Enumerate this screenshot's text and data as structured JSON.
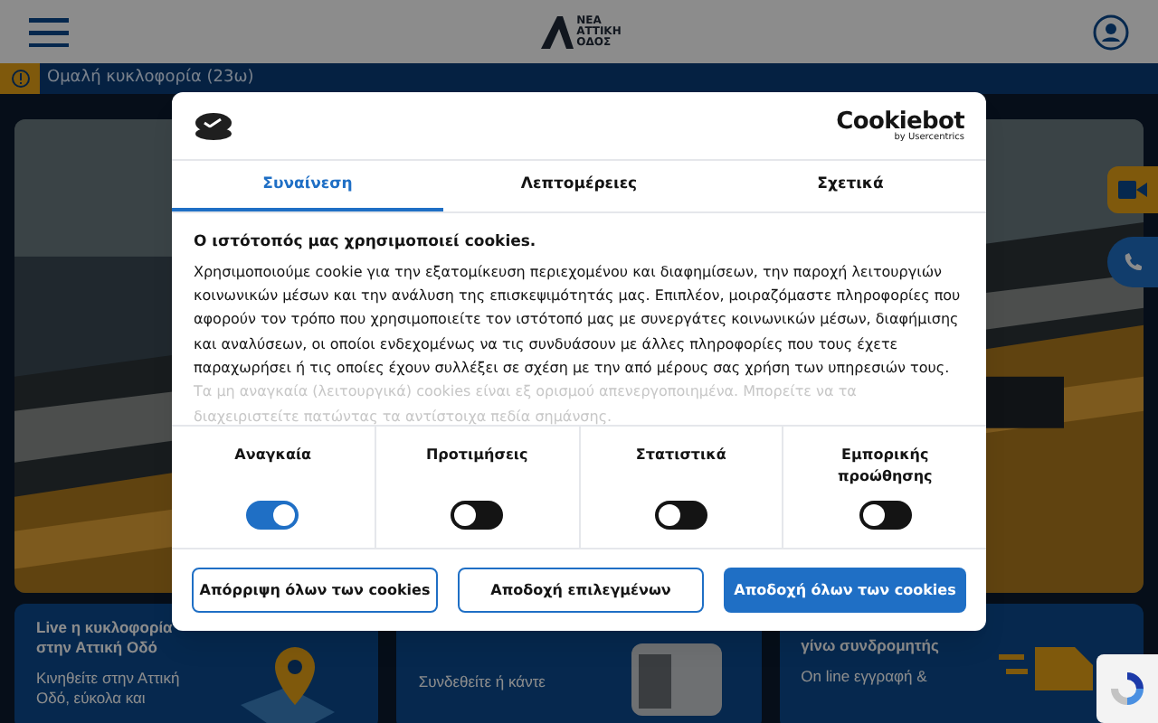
{
  "header": {
    "logo": [
      "ΝΕΑ",
      "ΑΤΤΙΚΗ",
      "ΟΔΟΣ"
    ]
  },
  "traffic_bar": {
    "text": "Ομαλή κυκλοφορία (23ω)"
  },
  "cards": [
    {
      "title": "Live η κυκλοφορία στην Αττική Οδό",
      "text": "Κινηθείτε στην Αττική Οδό, εύκολα και",
      "kind": "map"
    },
    {
      "text": "Συνδεθείτε ή κάντε",
      "kind": "pass"
    },
    {
      "title": "γίνω συνδρομητής",
      "text": "On line εγγραφή &",
      "kind": "truck"
    }
  ],
  "cookie_dialog": {
    "brand": "Cookiebot",
    "brand_sub": "by Usercentrics",
    "tabs": [
      {
        "label": "Συναίνεση",
        "selected": true
      },
      {
        "label": "Λεπτομέρειες",
        "selected": false
      },
      {
        "label": "Σχετικά",
        "selected": false
      }
    ],
    "heading": "Ο ιστότοπός μας χρησιμοποιεί cookies.",
    "body": "Χρησιμοποιούμε cookie για την εξατομίκευση περιεχομένου και διαφημίσεων, την παροχή λειτουργιών κοινωνικών μέσων και την ανάλυση της επισκεψιμότητάς μας. Επιπλέον, μοιραζόμαστε πληροφορίες που αφορούν τον τρόπο που χρησιμοποιείτε τον ιστότοπό μας με συνεργάτες κοινωνικών μέσων, διαφήμισης και αναλύσεων, οι οποίοι ενδεχομένως να τις συνδυάσουν με άλλες πληροφορίες που τους έχετε παραχωρήσει ή τις οποίες έχουν συλλέξει σε σχέση με την από μέρους σας χρήση των υπηρεσιών τους.",
    "note": "Τα μη αναγκαία (λειτουργικά) cookies είναι εξ ορισμού απενεργοποιημένα. Μπορείτε να τα διαχειριστείτε πατώντας τα αντίστοιχα πεδία σημάνσης.",
    "categories": [
      {
        "label": "Αναγκαία",
        "on": true
      },
      {
        "label": "Προτιμήσεις",
        "on": false
      },
      {
        "label": "Στατιστικά",
        "on": false
      },
      {
        "label": "Εμπορικής προώθησης",
        "on": false
      }
    ],
    "buttons": [
      {
        "label": "Απόρριψη όλων των cookies",
        "kind": "outline"
      },
      {
        "label": "Αποδοχή επιλεγμένων",
        "kind": "outline"
      },
      {
        "label": "Αποδοχή όλων των cookies",
        "kind": "primary"
      }
    ]
  }
}
